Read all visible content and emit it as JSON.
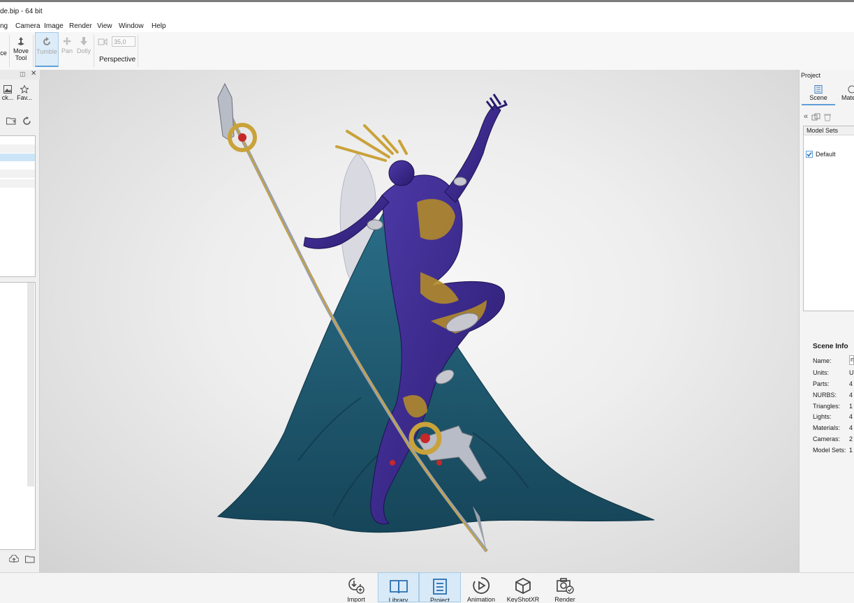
{
  "window": {
    "title": "de.bip  - 64 bit"
  },
  "menu": [
    "ng",
    "Camera",
    "Image",
    "Render",
    "View",
    "Window",
    "Help"
  ],
  "ribbon": {
    "ce_label": "ce",
    "move_tool_label": "Move\nTool",
    "tumble_label": "Tumble",
    "pan_label": "Pan",
    "dolly_label": "Dolly",
    "fov_value": "35,0",
    "perspective_label": "Perspective"
  },
  "left_panel": {
    "tab_back_label": "ck...",
    "tab_favorites_label": "Fav..."
  },
  "right_panel": {
    "header": "Project",
    "tabs": [
      {
        "label": "Scene"
      },
      {
        "label": "Mate"
      }
    ],
    "model_sets_header": "Model Sets",
    "model_set_default": "Default",
    "scene_info_title": "Scene Info",
    "scene_info": [
      {
        "label": "Name:",
        "value": "n"
      },
      {
        "label": "Units:",
        "value": "U"
      },
      {
        "label": "Parts:",
        "value": "4"
      },
      {
        "label": "NURBS:",
        "value": "4"
      },
      {
        "label": "Triangles:",
        "value": "1"
      },
      {
        "label": "Lights:",
        "value": "4"
      },
      {
        "label": "Materials:",
        "value": "4"
      },
      {
        "label": "Cameras:",
        "value": "2"
      },
      {
        "label": "Model Sets:",
        "value": "1"
      }
    ]
  },
  "bottom_bar": {
    "buttons": [
      {
        "label": "Import",
        "icon": "import-icon",
        "active": false
      },
      {
        "label": "Library",
        "icon": "library-icon",
        "active": true
      },
      {
        "label": "Project",
        "icon": "project-icon",
        "active": true
      },
      {
        "label": "Animation",
        "icon": "animation-icon",
        "active": false
      },
      {
        "label": "KeyShotXR",
        "icon": "keyshotxr-icon",
        "active": false
      },
      {
        "label": "Render",
        "icon": "render-icon",
        "active": false
      }
    ]
  },
  "colors": {
    "accent": "#5ea0d8",
    "selection": "#cce4f7",
    "character_body": "#3b2a8c",
    "cape": "#1f5a73",
    "gold": "#b08a2a"
  }
}
